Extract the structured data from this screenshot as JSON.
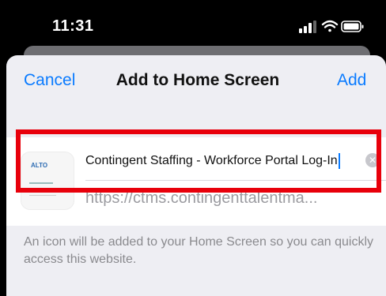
{
  "status_bar": {
    "time": "11:31",
    "icons": [
      "cellular-signal-icon",
      "wifi-icon",
      "battery-icon"
    ]
  },
  "sheet": {
    "cancel_label": "Cancel",
    "title": "Add to Home Screen",
    "add_label": "Add",
    "app": {
      "name": "Contingent Staffing - Workforce Portal Log-In",
      "url": "https://ctms.contingenttalentma...",
      "thumbnail_logo": "ALTO"
    },
    "hint": "An icon will be added to your Home Screen so you can quickly access this website."
  },
  "colors": {
    "accent": "#0a7bff",
    "highlight": "#e8000b",
    "sheet_bg": "#eeeef3"
  }
}
